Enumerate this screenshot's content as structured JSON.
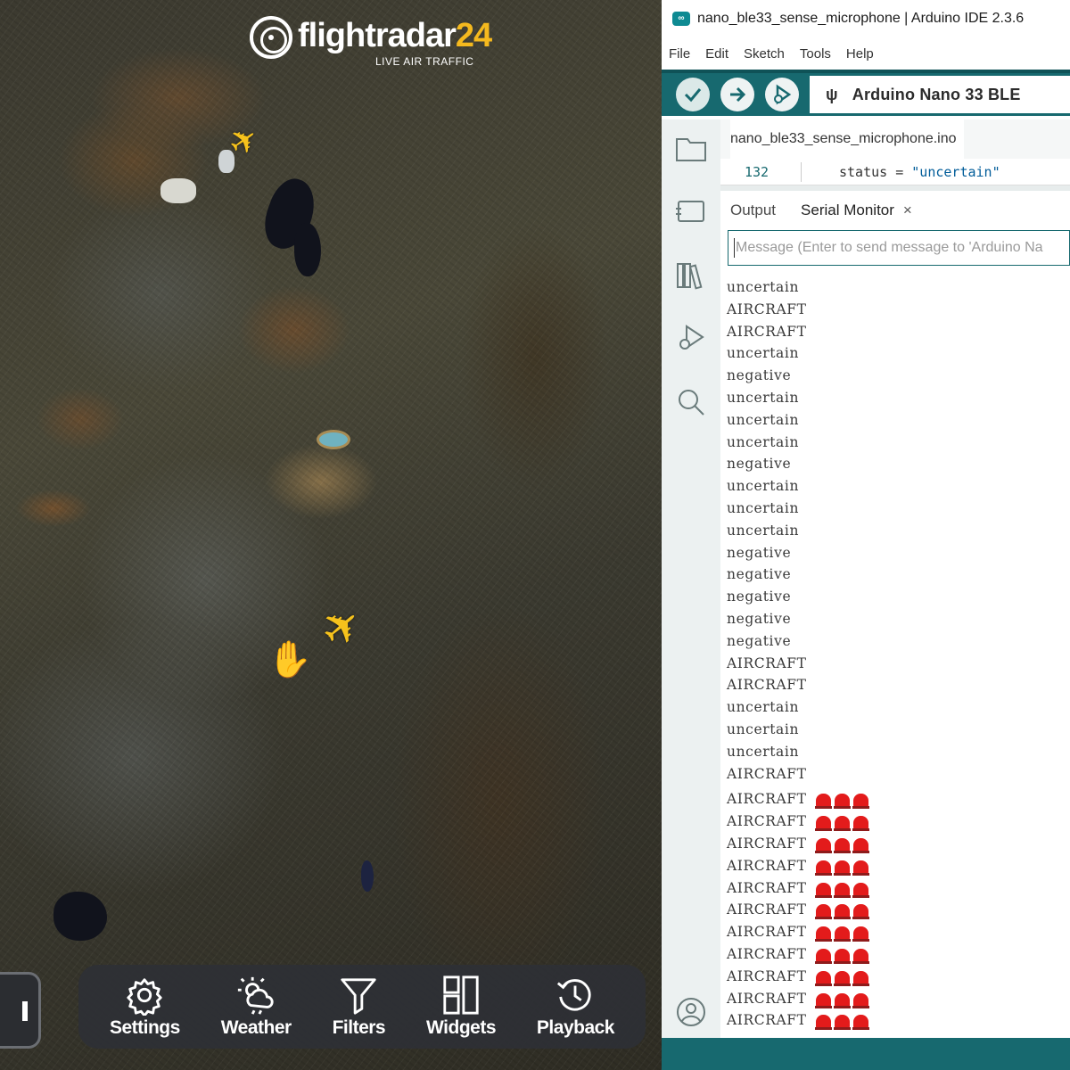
{
  "map": {
    "brand_word": "flightradar",
    "brand_number": "24",
    "tagline": "LIVE AIR TRAFFIC",
    "plane_icon": "airplane-icon",
    "cursor_icon": "hand-cursor-icon",
    "accent_color": "#f6c21c",
    "bottom_bar": {
      "items": [
        {
          "label": "Settings",
          "icon": "gear-icon"
        },
        {
          "label": "Weather",
          "icon": "weather-icon"
        },
        {
          "label": "Filters",
          "icon": "filter-icon"
        },
        {
          "label": "Widgets",
          "icon": "widgets-icon"
        },
        {
          "label": "Playback",
          "icon": "history-icon"
        }
      ]
    }
  },
  "ide": {
    "title": "nano_ble33_sense_microphone | Arduino IDE 2.3.6",
    "menu": [
      "File",
      "Edit",
      "Sketch",
      "Tools",
      "Help"
    ],
    "board": "Arduino Nano 33 BLE",
    "accent_color": "#17696f",
    "file_tab": "nano_ble33_sense_microphone.ino",
    "code_line": {
      "number": "132",
      "code": "status = ",
      "string": "\"uncertain\""
    },
    "panel_tabs": {
      "output": "Output",
      "serial": "Serial Monitor",
      "close": "×"
    },
    "message_placeholder": "Message (Enter to send message to 'Arduino Na",
    "serial_lines": [
      "uncertain",
      "AIRCRAFT",
      "AIRCRAFT",
      "uncertain",
      "negative",
      "uncertain",
      "uncertain",
      "uncertain",
      "negative",
      "uncertain",
      "uncertain",
      "uncertain",
      "negative",
      "negative",
      "negative",
      "negative",
      "negative",
      "AIRCRAFT",
      "AIRCRAFT",
      "uncertain",
      "uncertain",
      "uncertain",
      "AIRCRAFT"
    ],
    "alarm_lines": [
      "AIRCRAFT",
      "AIRCRAFT",
      "AIRCRAFT",
      "AIRCRAFT",
      "AIRCRAFT",
      "AIRCRAFT",
      "AIRCRAFT",
      "AIRCRAFT",
      "AIRCRAFT",
      "AIRCRAFT",
      "AIRCRAFT"
    ],
    "alarm_icon": "siren-icon",
    "alarm_count": 3
  }
}
